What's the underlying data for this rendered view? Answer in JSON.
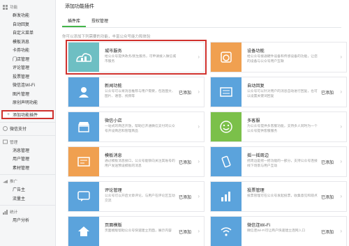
{
  "sidebar": {
    "function_section": "功能",
    "function_items": [
      "群发功能",
      "自动回复",
      "自定义菜单",
      "模板消息",
      "卡券功能",
      "门店管理",
      "评论管理",
      "投票管理",
      "微信连Wi-Fi",
      "图片管理",
      "原创声明功能"
    ],
    "add_plugin": "添加功能插件",
    "wechat_pay": "微信支付",
    "management_section": "管理",
    "management_items": [
      "消息管理",
      "用户管理",
      "素材管理"
    ],
    "promotion_section": "推广",
    "promotion_items": [
      "广告主",
      "流量主"
    ],
    "stats_section": "统计",
    "stats_items": [
      "用户分析"
    ]
  },
  "main": {
    "page_title": "添加功能插件",
    "tabs": [
      "插件库",
      "授权管理"
    ],
    "description": "你可以添加下列需要的功能，丰富公众号能力和体验",
    "cards": [
      {
        "title": "城市服务",
        "text": "给公众号提供政务/民生服务，可申请接入微信城市服务",
        "status": "",
        "icon": "city-icon",
        "color": "#6ebfc3"
      },
      {
        "title": "设备功能",
        "text": "给公众号接通硬件设备和传感设备的功能，让您的设备与公众号用户互联",
        "status": "",
        "icon": "device-icon",
        "color": "#f0a050"
      },
      {
        "title": "新闻功能",
        "text": "公众号可以将消息推荐与用户需要，包括图文、图片、语音、视频等",
        "status": "已添加",
        "icon": "news-icon",
        "color": "#5ba3dc"
      },
      {
        "title": "自动回复",
        "text": "公众号可以针对用户的消息自动进行回复，也可以设置关键词回复",
        "status": "已添加",
        "icon": "reply-icon",
        "color": "#5ba3dc"
      },
      {
        "title": "微信小店",
        "text": "一站式的商店开放，帮助已开通微信支付的公众号开设商店和管理商品",
        "status": "",
        "icon": "shop-icon",
        "color": "#5ba3dc"
      },
      {
        "title": "多客服",
        "text": "为公众号提供多客服功能，支持多人同时为一个公众号提供客服服务",
        "status": "",
        "icon": "service-icon",
        "color": "#7bc04a"
      },
      {
        "title": "模板消息",
        "text": "通过模板消息接口，公众号能够向关注其账号的用户发送预设模板的消息",
        "status": "已添加",
        "icon": "template-icon",
        "color": "#f0a050"
      },
      {
        "title": "摇一摇周边",
        "text": "摇周边是摇一摇功能的一部分，支持公众号连接线下场景与用户互动",
        "status": "已添加",
        "icon": "shake-icon",
        "color": "#5ba3dc"
      },
      {
        "title": "评论管理",
        "text": "公众号可以开启文章评论，与用户在评论区互动交流",
        "status": "已添加",
        "icon": "comment-icon",
        "color": "#5ba3dc"
      },
      {
        "title": "投票管理",
        "text": "投票管理可在公众号发起投票，收集意见和观点",
        "status": "已添加",
        "icon": "vote-icon",
        "color": "#5ba3dc"
      },
      {
        "title": "页面模版",
        "text": "页面模版帮助公众号快速建立页面，展示内容",
        "status": "已添加",
        "icon": "page-template-icon",
        "color": "#5ba3dc"
      },
      {
        "title": "微信连Wi-Fi",
        "text": "微信连Wi-Fi可让商户快速建立连网入口",
        "status": "已添加",
        "icon": "wifi-icon",
        "color": "#5ba3dc"
      }
    ]
  },
  "colors": {
    "highlight": "#d0312d",
    "accent": "#44b549"
  }
}
